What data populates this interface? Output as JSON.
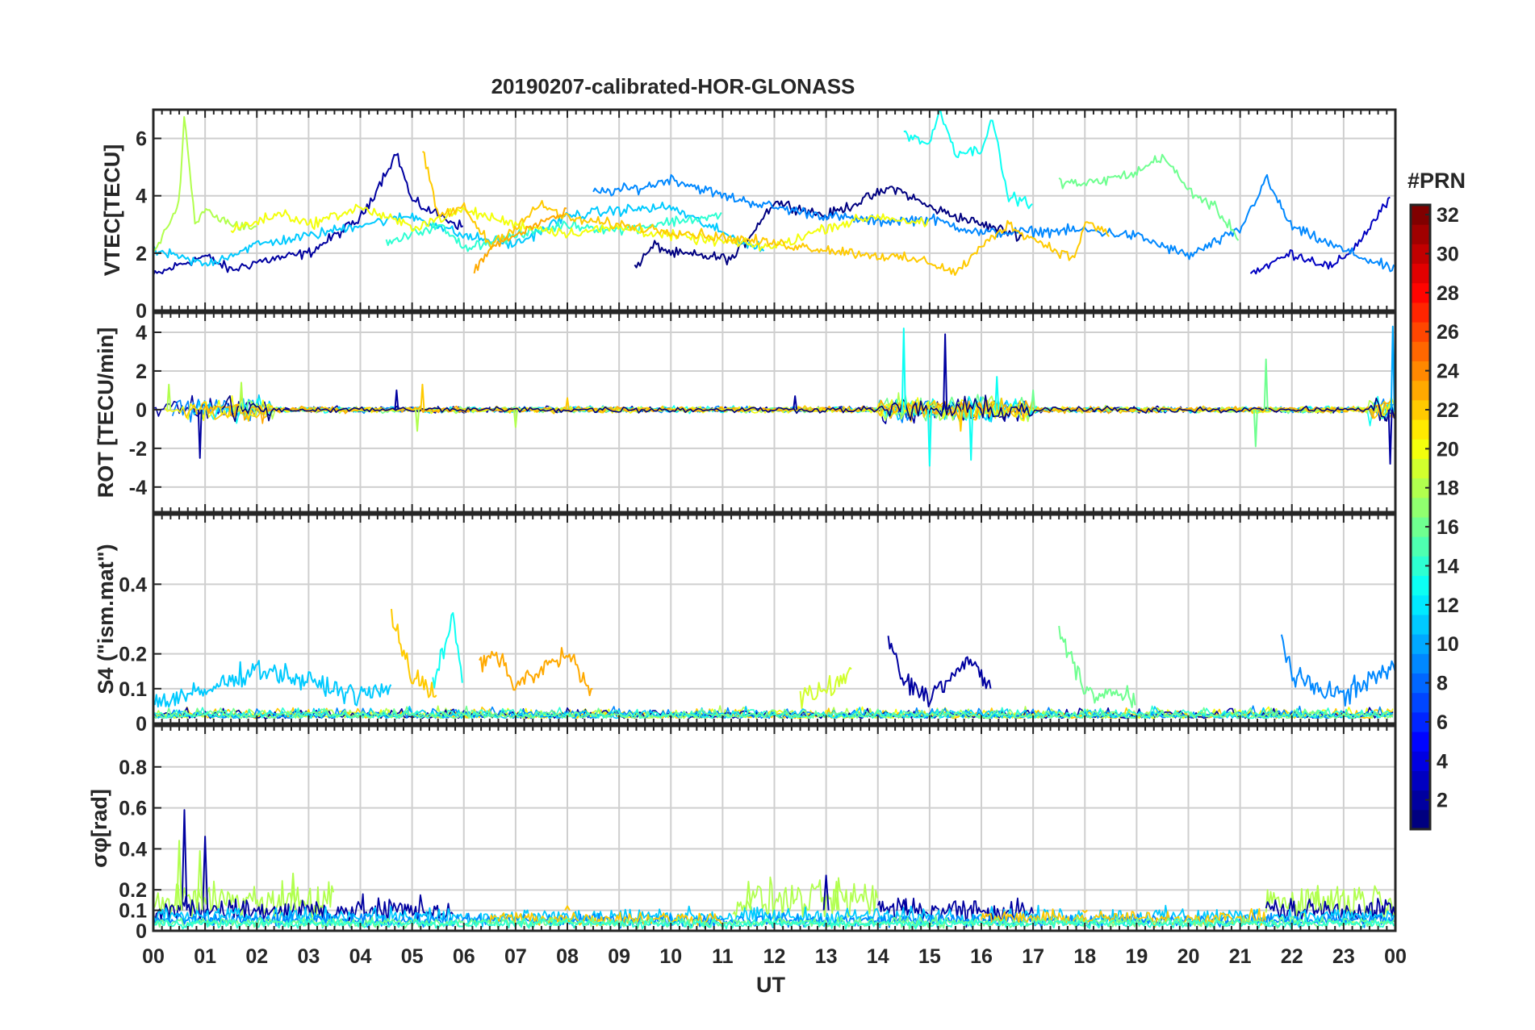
{
  "title": "20190207-calibrated-HOR-GLONASS",
  "x_axis": {
    "label": "UT",
    "ticks": [
      "00",
      "01",
      "02",
      "03",
      "04",
      "05",
      "06",
      "07",
      "08",
      "09",
      "10",
      "11",
      "12",
      "13",
      "14",
      "15",
      "16",
      "17",
      "18",
      "19",
      "20",
      "21",
      "22",
      "23",
      "00"
    ]
  },
  "colorbar": {
    "title": "#PRN",
    "range": [
      1,
      32
    ],
    "colormap": "jet",
    "ticks": [
      "2",
      "4",
      "6",
      "8",
      "10",
      "12",
      "14",
      "16",
      "18",
      "20",
      "22",
      "24",
      "26",
      "28",
      "30",
      "32"
    ]
  },
  "chart_data": [
    {
      "type": "line",
      "panel": "vtec",
      "ylabel": "VTEC[TECU]",
      "ylim": [
        0,
        7
      ],
      "yticks": [
        "0",
        "2",
        "4",
        "6"
      ],
      "xlim": [
        0,
        24
      ],
      "grid": true,
      "series": [
        {
          "prn": 2,
          "points": [
            [
              0,
              1.2
            ],
            [
              0.5,
              1.6
            ],
            [
              1,
              1.9
            ],
            [
              1.5,
              1.4
            ],
            [
              2,
              1.7
            ],
            [
              3,
              2.0
            ],
            [
              4,
              3.2
            ],
            [
              4.7,
              5.5
            ],
            [
              5,
              3.8
            ],
            [
              6,
              2.9
            ]
          ]
        },
        {
          "prn": 1,
          "points": [
            [
              9.3,
              1.5
            ],
            [
              9.7,
              2.3
            ],
            [
              10,
              2.0
            ],
            [
              11.2,
              1.8
            ],
            [
              12,
              3.8
            ],
            [
              13,
              3.3
            ],
            [
              14.3,
              4.3
            ],
            [
              15,
              3.6
            ],
            [
              16,
              3.0
            ],
            [
              16.8,
              2.6
            ]
          ]
        },
        {
          "prn": 3,
          "points": [
            [
              21.2,
              1.3
            ],
            [
              22,
              2.0
            ],
            [
              22.8,
              1.5
            ],
            [
              23.3,
              2.4
            ],
            [
              23.9,
              3.9
            ]
          ]
        },
        {
          "prn": 9,
          "points": [
            [
              8.5,
              4.1
            ],
            [
              9.5,
              4.3
            ],
            [
              10,
              4.6
            ],
            [
              11,
              4.0
            ],
            [
              12,
              3.6
            ],
            [
              13,
              3.3
            ],
            [
              14,
              3.1
            ],
            [
              15,
              3.2
            ],
            [
              16,
              2.7
            ],
            [
              18,
              2.8
            ],
            [
              19,
              2.6
            ],
            [
              20,
              1.9
            ],
            [
              21,
              2.8
            ],
            [
              21.5,
              4.6
            ],
            [
              22,
              2.9
            ],
            [
              23,
              2.1
            ],
            [
              24,
              1.4
            ]
          ]
        },
        {
          "prn": 11,
          "points": [
            [
              0,
              2.1
            ],
            [
              1,
              1.6
            ],
            [
              2,
              2.3
            ],
            [
              3,
              2.6
            ],
            [
              4,
              3.0
            ],
            [
              5,
              3.3
            ],
            [
              6,
              2.6
            ],
            [
              7,
              2.3
            ],
            [
              8,
              3.3
            ],
            [
              9,
              3.5
            ],
            [
              10,
              3.6
            ],
            [
              11,
              2.7
            ],
            [
              11.8,
              2.1
            ]
          ]
        },
        {
          "prn": 13,
          "points": [
            [
              14.5,
              6.2
            ],
            [
              15,
              5.8
            ],
            [
              15.2,
              7.0
            ],
            [
              15.5,
              5.5
            ],
            [
              16,
              5.6
            ],
            [
              16.2,
              6.8
            ],
            [
              16.5,
              4.0
            ],
            [
              17,
              3.7
            ]
          ]
        },
        {
          "prn": 14,
          "points": [
            [
              4.5,
              2.3
            ],
            [
              5.5,
              3.0
            ],
            [
              6,
              2.2
            ],
            [
              7,
              2.6
            ],
            [
              8,
              3.0
            ],
            [
              9,
              2.8
            ],
            [
              10,
              3.1
            ],
            [
              11,
              3.3
            ]
          ]
        },
        {
          "prn": 16,
          "points": [
            [
              17.5,
              4.5
            ],
            [
              18,
              4.4
            ],
            [
              19,
              4.8
            ],
            [
              19.5,
              5.4
            ],
            [
              20,
              4.2
            ],
            [
              20.5,
              3.6
            ],
            [
              21,
              2.5
            ]
          ]
        },
        {
          "prn": 18,
          "points": [
            [
              0,
              2.0
            ],
            [
              0.5,
              3.7
            ],
            [
              0.6,
              6.8
            ],
            [
              0.8,
              3.0
            ],
            [
              1,
              3.5
            ],
            [
              1.5,
              3.0
            ],
            [
              2,
              2.9
            ]
          ]
        },
        {
          "prn": 20,
          "points": [
            [
              1.5,
              2.8
            ],
            [
              2.5,
              3.4
            ],
            [
              3,
              3.0
            ],
            [
              4,
              3.6
            ],
            [
              5,
              2.9
            ],
            [
              6,
              3.5
            ],
            [
              7,
              3.0
            ],
            [
              8,
              2.7
            ],
            [
              9,
              2.9
            ],
            [
              10,
              2.6
            ],
            [
              11,
              2.4
            ],
            [
              12,
              2.2
            ],
            [
              13,
              2.9
            ],
            [
              14,
              3.3
            ],
            [
              15,
              3.0
            ]
          ]
        },
        {
          "prn": 22,
          "points": [
            [
              5.2,
              5.6
            ],
            [
              5.5,
              3.3
            ],
            [
              6,
              3.6
            ],
            [
              6.5,
              2.3
            ],
            [
              7,
              2.9
            ],
            [
              7.5,
              3.7
            ],
            [
              8,
              3.2
            ],
            [
              15,
              1.7
            ],
            [
              15.5,
              1.3
            ],
            [
              16,
              2.2
            ],
            [
              16.5,
              3.0
            ],
            [
              17,
              2.5
            ],
            [
              17.8,
              1.8
            ],
            [
              18,
              3.1
            ],
            [
              18.5,
              2.6
            ]
          ]
        },
        {
          "prn": 23,
          "points": [
            [
              6.2,
              1.4
            ],
            [
              6.6,
              2.3
            ],
            [
              7,
              2.6
            ],
            [
              7.5,
              3.1
            ],
            [
              8,
              3.4
            ]
          ]
        }
      ]
    },
    {
      "type": "line",
      "panel": "rot",
      "ylabel": "ROT [TECU/min]",
      "ylim": [
        -5.3,
        5
      ],
      "yticks": [
        "-4",
        "-2",
        "0",
        "2",
        "4"
      ],
      "xlim": [
        0,
        24
      ],
      "grid": true,
      "series": [
        {
          "prn": 2,
          "peaks": [
            [
              0.9,
              -2.5
            ],
            [
              4.7,
              1.0
            ],
            [
              12.4,
              0.7
            ],
            [
              15.3,
              3.9
            ],
            [
              23.9,
              -2.8
            ]
          ]
        },
        {
          "prn": 13,
          "peaks": [
            [
              14.5,
              4.2
            ],
            [
              15.0,
              -2.9
            ],
            [
              15.8,
              -2.6
            ],
            [
              16.3,
              1.7
            ]
          ]
        },
        {
          "prn": 16,
          "peaks": [
            [
              17.0,
              1.0
            ],
            [
              21.3,
              -1.9
            ],
            [
              21.5,
              2.6
            ]
          ]
        },
        {
          "prn": 18,
          "peaks": [
            [
              0.3,
              1.3
            ],
            [
              1.7,
              1.4
            ],
            [
              5.1,
              -1.1
            ],
            [
              7.0,
              -0.9
            ]
          ]
        },
        {
          "prn": 22,
          "peaks": [
            [
              5.2,
              1.3
            ],
            [
              8.0,
              0.6
            ],
            [
              15.6,
              -1.1
            ]
          ]
        },
        {
          "prn": 10,
          "peaks": [
            [
              23.95,
              4.3
            ]
          ]
        }
      ]
    },
    {
      "type": "line",
      "panel": "s4",
      "ylabel": "S4 (\"ism.mat\")",
      "ylim": [
        0,
        0.6
      ],
      "yticks": [
        "0",
        "0.1",
        "0.2",
        "0.4"
      ],
      "xlim": [
        0,
        24
      ],
      "grid": true,
      "series": [
        {
          "prn": 11,
          "segments": [
            [
              0,
              0.06
            ],
            [
              1,
              0.09
            ],
            [
              2,
              0.16
            ],
            [
              3,
              0.12
            ],
            [
              4,
              0.08
            ],
            [
              4.6,
              0.1
            ]
          ]
        },
        {
          "prn": 13,
          "segments": [
            [
              5.4,
              0.12
            ],
            [
              5.8,
              0.3
            ],
            [
              6.0,
              0.1
            ]
          ]
        },
        {
          "prn": 22,
          "segments": [
            [
              4.6,
              0.32
            ],
            [
              5,
              0.13
            ],
            [
              5.5,
              0.08
            ]
          ]
        },
        {
          "prn": 23,
          "segments": [
            [
              6.3,
              0.16
            ],
            [
              6.6,
              0.2
            ],
            [
              7,
              0.11
            ],
            [
              8,
              0.2
            ],
            [
              8.5,
              0.08
            ]
          ]
        },
        {
          "prn": 2,
          "segments": [
            [
              14.2,
              0.24
            ],
            [
              14.5,
              0.12
            ],
            [
              15,
              0.08
            ],
            [
              15.8,
              0.18
            ],
            [
              16.2,
              0.1
            ]
          ]
        },
        {
          "prn": 9,
          "segments": [
            [
              21.8,
              0.26
            ],
            [
              22,
              0.13
            ],
            [
              23,
              0.08
            ],
            [
              24,
              0.17
            ]
          ]
        },
        {
          "prn": 16,
          "segments": [
            [
              17.5,
              0.26
            ],
            [
              18,
              0.1
            ],
            [
              19,
              0.07
            ]
          ]
        },
        {
          "prn": 19,
          "segments": [
            [
              12.5,
              0.07
            ],
            [
              13,
              0.1
            ],
            [
              13.5,
              0.14
            ]
          ]
        }
      ]
    },
    {
      "type": "line",
      "panel": "sigma_phi",
      "ylabel": "σφ[rad]",
      "ylim": [
        0,
        1
      ],
      "yticks": [
        "0",
        "0.1",
        "0.2",
        "0.4",
        "0.6",
        "0.8"
      ],
      "xlim": [
        0,
        24
      ],
      "grid": true,
      "series": [
        {
          "prn": 2,
          "peaks": [
            [
              0.6,
              0.59
            ],
            [
              1.0,
              0.46
            ],
            [
              13,
              0.27
            ],
            [
              14.5,
              0.15
            ]
          ]
        },
        {
          "prn": 18,
          "peaks": [
            [
              0.5,
              0.44
            ],
            [
              0.9,
              0.39
            ],
            [
              2.7,
              0.28
            ],
            [
              11.5,
              0.24
            ],
            [
              13.2,
              0.24
            ],
            [
              22.5,
              0.22
            ]
          ]
        },
        {
          "prn": 22,
          "peaks": [
            [
              8,
              0.12
            ],
            [
              18,
              0.09
            ]
          ]
        }
      ]
    }
  ]
}
